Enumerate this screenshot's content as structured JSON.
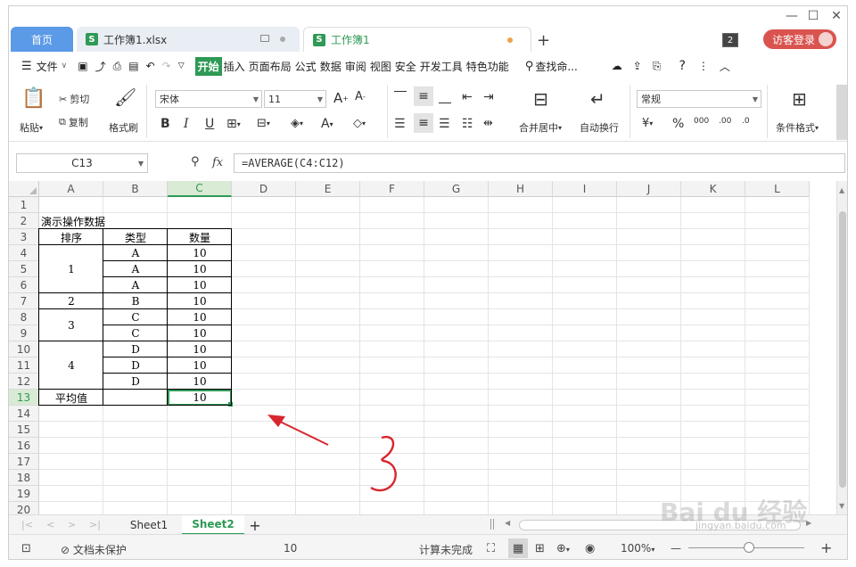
{
  "window": {
    "minimize": "—",
    "maximize": "☐",
    "close": "✕"
  },
  "tabs": {
    "home": "首页",
    "doc1": {
      "label": "工作簿1.xlsx",
      "icon": "S"
    },
    "doc2": {
      "label": "工作簿1",
      "icon": "S"
    },
    "new_tab": "+",
    "window_count": "2",
    "login": "访客登录"
  },
  "menu": {
    "file": "文件",
    "items": [
      "开始",
      "插入",
      "页面布局",
      "公式",
      "数据",
      "审阅",
      "视图",
      "安全",
      "开发工具",
      "特色功能"
    ],
    "search": "查找命..."
  },
  "ribbon": {
    "paste": "粘贴",
    "cut": "剪切",
    "copy": "复制",
    "format_painter": "格式刷",
    "font": "宋体",
    "font_size": "11",
    "bold": "B",
    "italic": "I",
    "underline": "U",
    "merge_center": "合并居中",
    "wrap_text": "自动换行",
    "number_format": "常规",
    "percent": "%",
    "cond_format": "条件格式"
  },
  "formula_bar": {
    "name_box": "C13",
    "fx": "fx",
    "formula": "=AVERAGE(C4:C12)"
  },
  "columns": [
    "A",
    "B",
    "C",
    "D",
    "E",
    "F",
    "G",
    "H",
    "I",
    "J",
    "K",
    "L"
  ],
  "rows": [
    "1",
    "2",
    "3",
    "4",
    "5",
    "6",
    "7",
    "8",
    "9",
    "10",
    "11",
    "12",
    "13",
    "14",
    "15",
    "16",
    "17",
    "18",
    "19",
    "20"
  ],
  "cells": {
    "title": "演示操作数据",
    "header_a": "排序",
    "header_b": "类型",
    "header_c": "数量",
    "a_group1": "1",
    "a_group2": "2",
    "a_group3": "3",
    "a_group4": "4",
    "b": [
      "A",
      "A",
      "A",
      "B",
      "C",
      "C",
      "D",
      "D",
      "D"
    ],
    "c": [
      "10",
      "10",
      "10",
      "10",
      "10",
      "10",
      "10",
      "10",
      "10"
    ],
    "avg_label": "平均值",
    "avg_value": "10"
  },
  "annotation": {
    "number": "3",
    "color": "#d8262f"
  },
  "sheets": {
    "sheet1": "Sheet1",
    "sheet2": "Sheet2",
    "add": "+"
  },
  "status": {
    "protect": "文档未保护",
    "value": "10",
    "calc": "计算未完成",
    "zoom": "100%",
    "zoom_minus": "—",
    "zoom_plus": "+"
  },
  "watermark": {
    "brand": "Bai du 经验",
    "url": "jingyan.baidu.com"
  }
}
